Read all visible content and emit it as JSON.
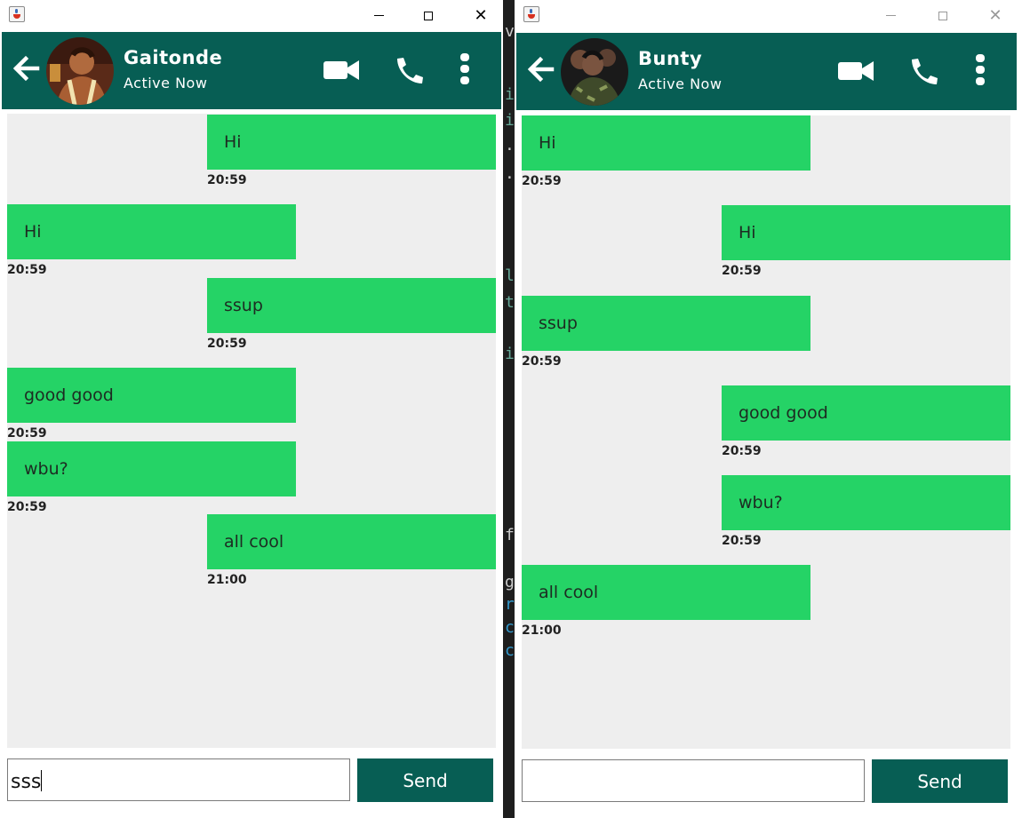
{
  "colors": {
    "header": "#075e54",
    "bubble": "#25d366",
    "chat_bg": "#eeeeee",
    "send_button": "#075e54"
  },
  "left_window": {
    "contact": {
      "name": "Gaitonde",
      "status": "Active Now"
    },
    "messages": [
      {
        "text": "Hi",
        "time": "20:59",
        "side": "right"
      },
      {
        "text": "Hi",
        "time": "20:59",
        "side": "left"
      },
      {
        "text": "ssup",
        "time": "20:59",
        "side": "right"
      },
      {
        "text": "good good",
        "time": "20:59",
        "side": "left"
      },
      {
        "text": "wbu?",
        "time": "20:59",
        "side": "left"
      },
      {
        "text": "all cool",
        "time": "21:00",
        "side": "right"
      }
    ],
    "input_value": "sss",
    "send_label": "Send"
  },
  "right_window": {
    "contact": {
      "name": "Bunty",
      "status": "Active Now"
    },
    "messages": [
      {
        "text": "Hi",
        "time": "20:59",
        "side": "left"
      },
      {
        "text": "Hi",
        "time": "20:59",
        "side": "right"
      },
      {
        "text": "ssup",
        "time": "20:59",
        "side": "left"
      },
      {
        "text": "good good",
        "time": "20:59",
        "side": "right"
      },
      {
        "text": "wbu?",
        "time": "20:59",
        "side": "right"
      },
      {
        "text": "all cool",
        "time": "21:00",
        "side": "left"
      }
    ],
    "input_value": "",
    "send_label": "Send"
  },
  "icons": {
    "app": "java-icon",
    "back": "arrow-left-icon",
    "video": "video-camera-icon",
    "call": "phone-icon",
    "menu": "more-vertical-icon"
  }
}
